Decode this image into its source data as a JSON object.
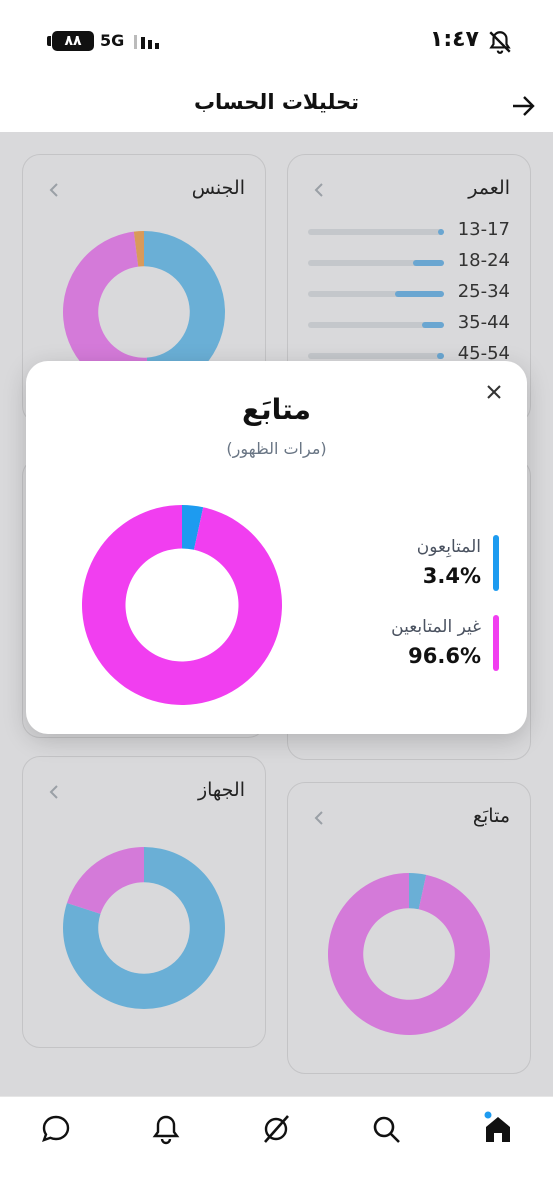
{
  "status": {
    "time": "١:٤٧",
    "battery": "٨٨",
    "network": "5G"
  },
  "header": {
    "title": "تحليلات الحساب"
  },
  "cards": {
    "gender": {
      "title": "الجنس"
    },
    "age": {
      "title": "العمر",
      "rows": [
        {
          "label": "13-17",
          "fill": 0.02
        },
        {
          "label": "18-24",
          "fill": 0.24
        },
        {
          "label": "25-34",
          "fill": 0.38
        },
        {
          "label": "35-44",
          "fill": 0.17
        },
        {
          "label": "45-54",
          "fill": 0.05
        }
      ]
    },
    "device": {
      "title": "الجهاز"
    },
    "follower": {
      "title": "متابَع"
    }
  },
  "modal": {
    "title": "متابَع",
    "subtitle": "(مرات الظهور)",
    "legend": [
      {
        "name": "المتابِعون",
        "value": "3.4%",
        "color": "#1d9bf0"
      },
      {
        "name": "غير المتابعين",
        "value": "96.6%",
        "color": "#f13ef0"
      }
    ]
  },
  "colors": {
    "blue": "#6aafd6",
    "pink": "#d47ad9",
    "orange": "#d99a5a",
    "overlay_blue": "#1d9bf0",
    "overlay_pink": "#f13ef0"
  },
  "tabs": [
    "home-icon",
    "search-icon",
    "grok-icon",
    "notifications-icon",
    "messages-icon"
  ],
  "chart_data": [
    {
      "type": "pie",
      "categories": [
        "المتابِعون",
        "غير المتابعين"
      ],
      "values": [
        3.4,
        96.6
      ],
      "title": "متابَع",
      "subtitle": "(مرات الظهور)"
    },
    {
      "type": "pie",
      "values": [
        49,
        49,
        2
      ]
    },
    {
      "type": "pie",
      "values": [
        80,
        20
      ]
    },
    {
      "type": "pie",
      "values": [
        3.4,
        96.6
      ]
    }
  ]
}
